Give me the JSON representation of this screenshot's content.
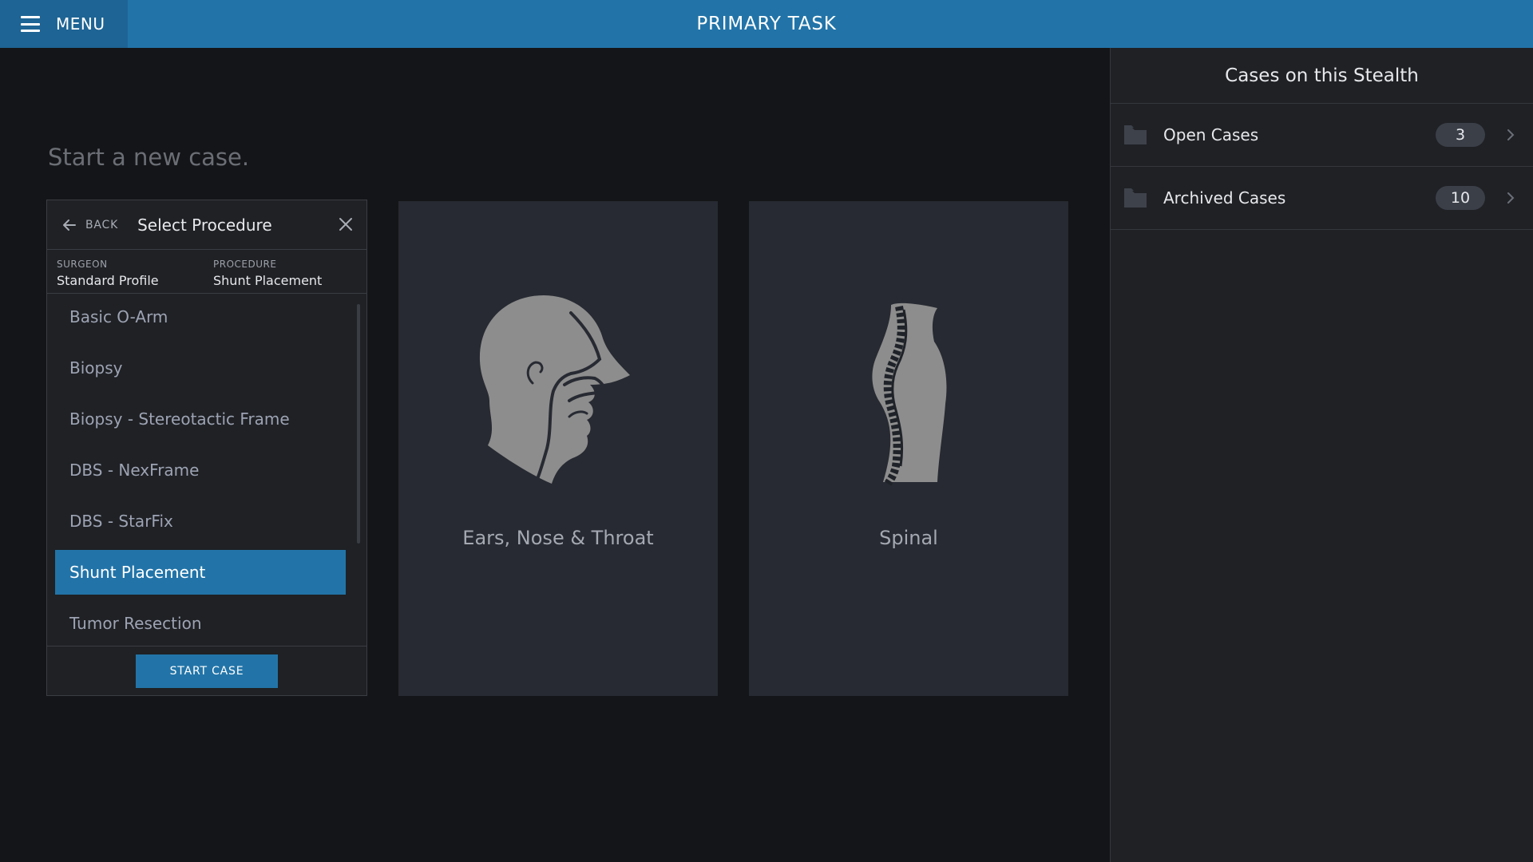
{
  "topbar": {
    "menu_label": "MENU",
    "title": "PRIMARY TASK"
  },
  "main": {
    "heading": "Start a new case."
  },
  "procedure_panel": {
    "back_label": "BACK",
    "title": "Select Procedure",
    "surgeon_label": "SURGEON",
    "surgeon_value": "Standard Profile",
    "procedure_label": "PROCEDURE",
    "procedure_value": "Shunt Placement",
    "items": [
      {
        "label": "Basic O-Arm"
      },
      {
        "label": "Biopsy"
      },
      {
        "label": "Biopsy - Stereotactic Frame"
      },
      {
        "label": "DBS - NexFrame"
      },
      {
        "label": "DBS - StarFix"
      },
      {
        "label": "Shunt Placement",
        "selected": true
      },
      {
        "label": "Tumor Resection"
      }
    ],
    "start_label": "START CASE"
  },
  "cards": [
    {
      "label": "Ears, Nose & Throat",
      "icon": "head-profile-icon"
    },
    {
      "label": "Spinal",
      "icon": "spine-icon"
    }
  ],
  "sidebar": {
    "title": "Cases on this Stealth",
    "rows": [
      {
        "label": "Open Cases",
        "count": "3"
      },
      {
        "label": "Archived Cases",
        "count": "10"
      }
    ]
  },
  "colors": {
    "accent": "#2274a8",
    "background": "#141518",
    "panel": "#1f2125",
    "card": "#272a32"
  }
}
